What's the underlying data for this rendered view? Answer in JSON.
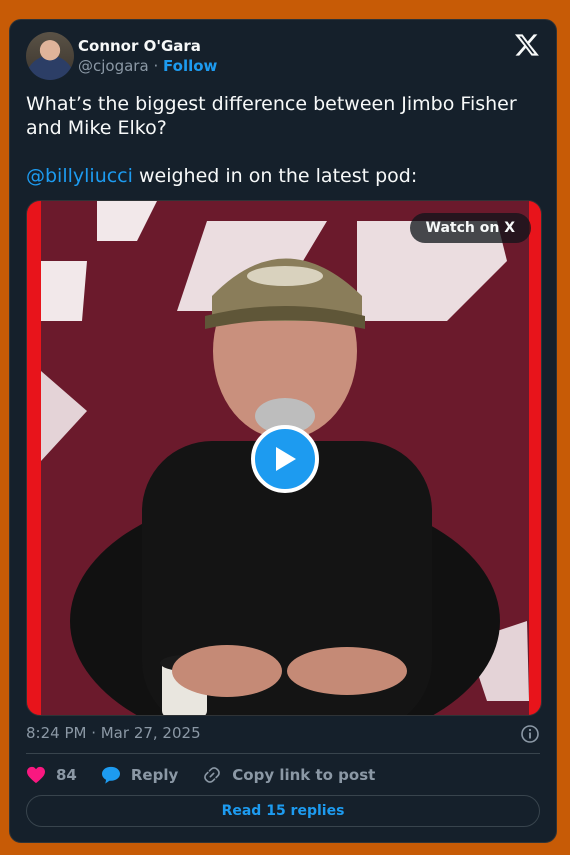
{
  "author": {
    "name": "Connor O'Gara",
    "handle": "@cjogara",
    "separator": "·",
    "follow_label": "Follow"
  },
  "tweet": {
    "line1": "What’s the biggest difference between Jimbo Fisher and Mike Elko?",
    "mention": "@billyliucci",
    "line2_rest": " weighed in on the latest pod:"
  },
  "media": {
    "watch_label": "Watch on X"
  },
  "timestamp": "8:24 PM · Mar 27, 2025",
  "actions": {
    "like_count": "84",
    "reply_label": "Reply",
    "copy_label": "Copy link to post"
  },
  "read_replies_label": "Read 15 replies",
  "colors": {
    "page_bg": "#c75b06",
    "card_bg": "#15202b",
    "accent": "#1d9bf0",
    "like": "#f91880"
  },
  "icons": [
    "x-logo-icon",
    "play-icon",
    "info-icon",
    "heart-icon",
    "reply-bubble-icon",
    "link-icon"
  ]
}
